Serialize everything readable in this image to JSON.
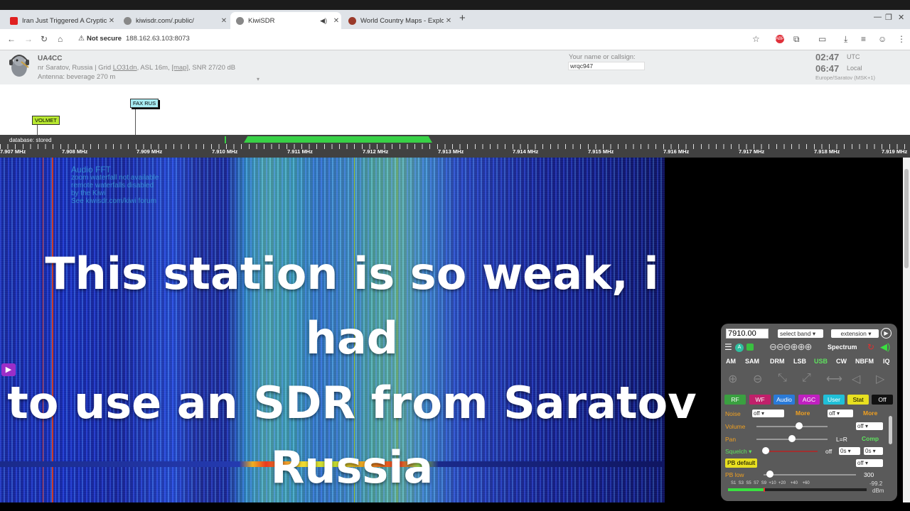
{
  "browser": {
    "tabs": [
      {
        "label": "Iran Just Triggered A Cryptic",
        "favicon_color": "#e02020",
        "active": false
      },
      {
        "label": "kiwisdr.com/.public/",
        "favicon_color": "#777777",
        "active": false
      },
      {
        "label": "KiwiSDR",
        "favicon_color": "#777777",
        "active": true
      },
      {
        "label": "World Country Maps - Explo",
        "favicon_color": "#9a3a2a",
        "active": false
      }
    ],
    "tab_close": "✕",
    "new_tab": "+",
    "security": "Not secure",
    "url": "188.162.63.103:8073"
  },
  "header": {
    "callsign": "UA4CC",
    "location_pre": "nr Saratov, Russia | Grid ",
    "grid": "LO31dn",
    "location_mid": ", ASL 16m, ",
    "map_link": "[map]",
    "location_post": ", SNR 27/20 dB",
    "antenna": "Antenna: beverage 270 m",
    "name_label": "Your name or callsign:",
    "name_value": "wrqc947",
    "utc_time": "02:47",
    "utc_label": "UTC",
    "local_time": "06:47",
    "local_label": "Local",
    "tz_name": "Europe/Saratov (MSK+1)"
  },
  "markers": [
    {
      "label": "VOLMET",
      "color": "#b8e830"
    },
    {
      "label": "FAX RUS",
      "color": "#a8ecf2"
    }
  ],
  "scale": {
    "db_status": "database: stored",
    "freq_labels": [
      "7.907 MHz",
      "7.908 MHz",
      "7.909 MHz",
      "7.910 MHz",
      "7.911 MHz",
      "7.912 MHz",
      "7.913 MHz",
      "7.914 MHz",
      "7.915 MHz",
      "7.916 MHz",
      "7.917 MHz",
      "7.918 MHz",
      "7.919 MHz"
    ]
  },
  "waterfall": {
    "overlay": [
      "Audio FFT",
      "zoom waterfall not available",
      "remote waterfalls disabled",
      "by the Kiwi",
      "",
      "See kiwisdr.com/kiwi forum"
    ]
  },
  "caption": {
    "line1": "This station is so weak, i had",
    "line2": "to use an SDR from Saratov",
    "line3": "Russia"
  },
  "control_panel": {
    "frequency": "7910.00",
    "band_select": "select band",
    "extension_select": "extension",
    "spectrum_label": "Spectrum",
    "modes": [
      "AM",
      "SAM",
      "DRM",
      "LSB",
      "USB",
      "CW",
      "NBFM",
      "IQ"
    ],
    "active_mode": "USB",
    "tabs": [
      {
        "label": "RF",
        "color": "#3aa040"
      },
      {
        "label": "WF",
        "color": "#c0206a"
      },
      {
        "label": "Audio",
        "color": "#2a7ad8"
      },
      {
        "label": "AGC",
        "color": "#c020c0"
      },
      {
        "label": "User",
        "color": "#20c0d8"
      },
      {
        "label": "Stat",
        "color": "#e8e020"
      },
      {
        "label": "Off",
        "color": "#111111"
      }
    ],
    "noise_label": "Noise",
    "noise_value": "off",
    "more1": "More",
    "noise2_value": "off",
    "more2": "More",
    "volume_label": "Volume",
    "volume_level": 0.6,
    "volume_mode": "off",
    "pan_label": "Pan",
    "pan_value": "L=R",
    "pan_level": 0.5,
    "comp_label": "Comp",
    "squelch_label": "Squelch",
    "squelch_off": "off",
    "squelch_t1": "0s",
    "squelch_t2": "0s",
    "pb_default": "PB default",
    "pb_select": "off",
    "pb_low_label": "PB low",
    "pb_low_value": "300",
    "smeter_scale": "S1  S3  S5  S7  S9  +10  +20    +40    +60",
    "smeter_value": "-99.2",
    "smeter_unit": "dBm"
  }
}
